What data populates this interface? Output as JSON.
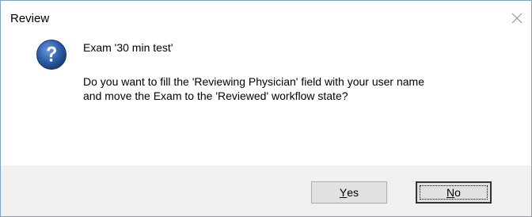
{
  "window": {
    "title": "Review",
    "close_icon": "close-icon"
  },
  "dialog": {
    "icon": "question-icon",
    "exam_title": "Exam '30 min test'",
    "message": "Do you want to fill the 'Reviewing Physician' field with your user name\nand move the Exam to the 'Reviewed' workflow state?"
  },
  "buttons": {
    "yes": {
      "mnemonic": "Y",
      "rest": "es"
    },
    "no": {
      "mnemonic": "N",
      "rest": "o"
    }
  },
  "colors": {
    "question_icon": "#2f5ea8",
    "border": "#7aa2cf",
    "footer": "#f0f0f0"
  }
}
